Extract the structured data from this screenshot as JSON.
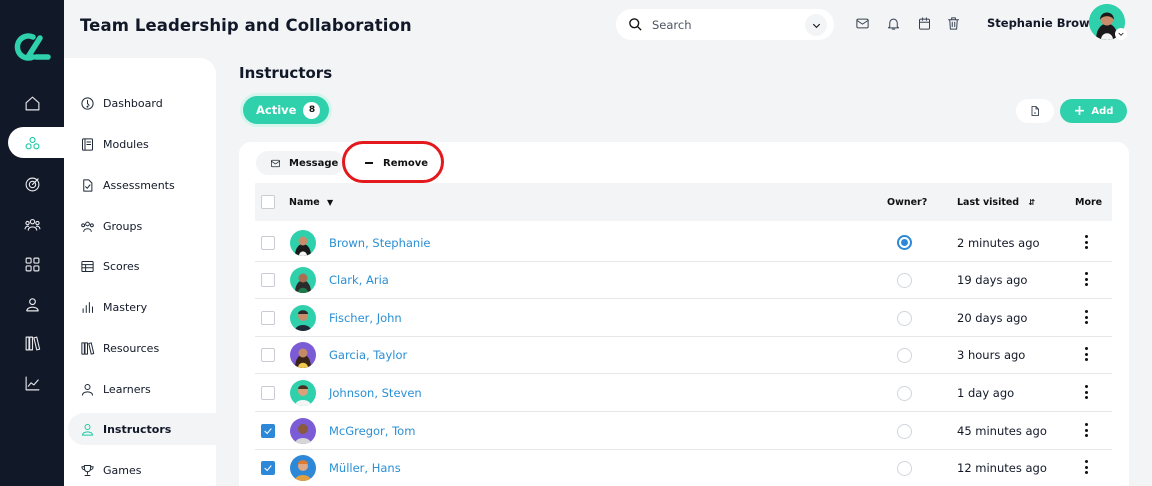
{
  "header": {
    "title": "Team Leadership and Collaboration",
    "search_placeholder": "Search",
    "user_name": "Stephanie Brown"
  },
  "rail_icons": [
    "home-icon",
    "modules-icon",
    "target-icon",
    "users-icon",
    "grid-icon",
    "person-icon",
    "library-icon",
    "chart-icon"
  ],
  "sidebar": {
    "items": [
      {
        "label": "Dashboard",
        "icon": "dashboard-icon"
      },
      {
        "label": "Modules",
        "icon": "book-icon"
      },
      {
        "label": "Assessments",
        "icon": "file-check-icon"
      },
      {
        "label": "Groups",
        "icon": "group-icon"
      },
      {
        "label": "Scores",
        "icon": "table-icon"
      },
      {
        "label": "Mastery",
        "icon": "bar-chart-icon"
      },
      {
        "label": "Resources",
        "icon": "books-icon"
      },
      {
        "label": "Learners",
        "icon": "learner-icon"
      },
      {
        "label": "Instructors",
        "icon": "instructor-icon"
      },
      {
        "label": "Games",
        "icon": "trophy-icon"
      }
    ],
    "active": "Instructors"
  },
  "main": {
    "title": "Instructors",
    "tab": {
      "label": "Active",
      "count": "8"
    },
    "add_label": "Add",
    "message_label": "Message",
    "remove_label": "Remove",
    "columns": {
      "name": "Name",
      "owner": "Owner?",
      "last_visited": "Last visited",
      "more": "More"
    },
    "rows": [
      {
        "name": "Brown, Stephanie",
        "owner": true,
        "visited": "2 minutes ago",
        "checked": false
      },
      {
        "name": "Clark, Aria",
        "owner": false,
        "visited": "19 days ago",
        "checked": false
      },
      {
        "name": "Fischer, John",
        "owner": false,
        "visited": "20 days ago",
        "checked": false
      },
      {
        "name": "Garcia, Taylor",
        "owner": false,
        "visited": "3 hours ago",
        "checked": false
      },
      {
        "name": "Johnson, Steven",
        "owner": false,
        "visited": "1 day ago",
        "checked": false
      },
      {
        "name": "McGregor, Tom",
        "owner": false,
        "visited": "45 minutes ago",
        "checked": true
      },
      {
        "name": "Müller, Hans",
        "owner": false,
        "visited": "12 minutes ago",
        "checked": true
      }
    ]
  },
  "colors": {
    "accent": "#2fd1ac",
    "link": "#2a8fd4",
    "highlight": "#e3191e",
    "rail": "#111827"
  }
}
